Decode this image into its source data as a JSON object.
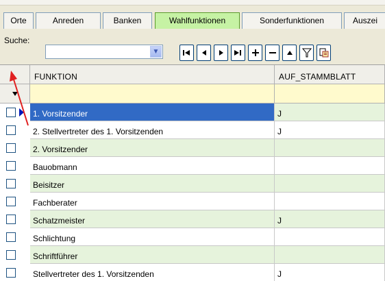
{
  "tabs": [
    {
      "label": "Orte",
      "active": false
    },
    {
      "label": "Anreden",
      "active": false
    },
    {
      "label": "Banken",
      "active": false
    },
    {
      "label": "Wahlfunktionen",
      "active": true
    },
    {
      "label": "Sonderfunktionen",
      "active": false
    },
    {
      "label": "Auszei",
      "active": false
    }
  ],
  "search": {
    "label": "Suche:",
    "value": ""
  },
  "nav_icons": [
    "first-record-icon",
    "prev-record-icon",
    "next-record-icon",
    "last-record-icon",
    "add-record-icon",
    "delete-record-icon",
    "up-icon",
    "filter-icon",
    "export-icon"
  ],
  "grid": {
    "columns": [
      "FUNKTION",
      "AUF_STAMMBLATT"
    ],
    "rows": [
      {
        "funktion": "1. Vorsitzender",
        "auf_stammblatt": "J",
        "current": true
      },
      {
        "funktion": "2. Stellvertreter des 1. Vorsitzenden",
        "auf_stammblatt": "J"
      },
      {
        "funktion": "2. Vorsitzender",
        "auf_stammblatt": ""
      },
      {
        "funktion": "Bauobmann",
        "auf_stammblatt": ""
      },
      {
        "funktion": "Beisitzer",
        "auf_stammblatt": ""
      },
      {
        "funktion": "Fachberater",
        "auf_stammblatt": ""
      },
      {
        "funktion": "Schatzmeister",
        "auf_stammblatt": "J"
      },
      {
        "funktion": "Schlichtung",
        "auf_stammblatt": ""
      },
      {
        "funktion": "Schriftführer",
        "auf_stammblatt": ""
      },
      {
        "funktion": "Stellvertreter des 1. Vorsitzenden",
        "auf_stammblatt": "J"
      }
    ]
  },
  "colors": {
    "active_tab": "#c6f2a4",
    "selection": "#316ac5",
    "alt_row": "#e6f3dc",
    "filter_row": "#fffacd",
    "annotation_arrow": "#e02020"
  }
}
